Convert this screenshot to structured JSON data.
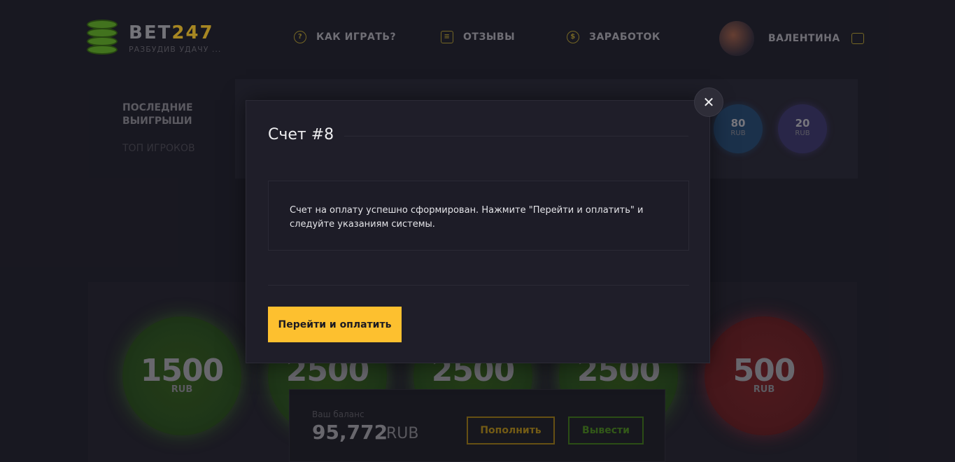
{
  "header": {
    "brand_main": "BET",
    "brand_num": "247",
    "tagline": "РАЗБУДИВ УДАЧУ ...",
    "nav": [
      {
        "label": "КАК ИГРАТЬ?",
        "icon": "question-icon"
      },
      {
        "label": "ОТЗЫВЫ",
        "icon": "chat-icon"
      },
      {
        "label": "ЗАРАБОТОК",
        "icon": "dollar-icon"
      }
    ],
    "user_name": "ВАЛЕНТИНА",
    "logout_icon": "logout-icon"
  },
  "winners": {
    "tab_active": "ПОСЛЕДНИЕ ВЫИГРЫШИ",
    "tab_inactive": "ТОП ИГРОКОВ",
    "items": [
      {
        "amount": "80",
        "currency": "RUB"
      },
      {
        "amount": "20",
        "currency": "RUB"
      }
    ]
  },
  "chips": [
    {
      "amount": "1500",
      "currency": "RUB",
      "color": "green"
    },
    {
      "amount": "2500",
      "currency": "",
      "color": "green"
    },
    {
      "amount": "2500",
      "currency": "",
      "color": "green"
    },
    {
      "amount": "2500",
      "currency": "",
      "color": "green"
    },
    {
      "amount": "500",
      "currency": "RUB",
      "color": "red"
    }
  ],
  "balance": {
    "label": "Ваш баланс",
    "value": "95,772",
    "currency": "RUB",
    "topup_label": "Пополнить",
    "withdraw_label": "Вывести"
  },
  "modal": {
    "title": "Счет #8",
    "message": "Счет на оплату успешно сформирован. Нажмите \"Перейти и оплатить\" и следуйте указаниям системы.",
    "pay_label": "Перейти и оплатить",
    "close_label": "✕"
  },
  "colors": {
    "accent": "#fdc02f",
    "green": "#4f8a22",
    "red": "#a82a33"
  }
}
